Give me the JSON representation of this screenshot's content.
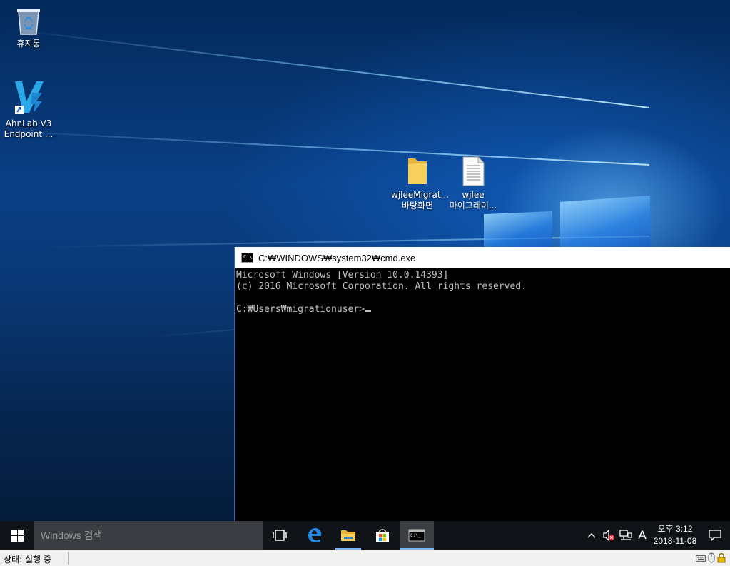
{
  "desktop_icons": {
    "recycle_bin": "휴지통",
    "ahnlab_line1": "AhnLab V3",
    "ahnlab_line2": "Endpoint ...",
    "folder_line1": "wjleeMigrat...",
    "folder_line2": "바탕화면",
    "doc_line1": "wjlee",
    "doc_line2": "마이그레이..."
  },
  "cmd_window": {
    "title": "C:₩WINDOWS₩system32₩cmd.exe",
    "lines": [
      "Microsoft Windows [Version 10.0.14393]",
      "(c) 2016 Microsoft Corporation. All rights reserved.",
      "",
      "C:₩Users₩migrationuser>"
    ]
  },
  "taskbar": {
    "search_placeholder": "Windows 검색",
    "apps": [
      "task-view",
      "edge",
      "file-explorer",
      "store",
      "cmd"
    ],
    "active_app": "cmd",
    "ime_indicator": "A",
    "clock_time": "오후 3:12",
    "clock_date": "2018-11-08"
  },
  "statusbar": {
    "text": "상태: 실행 중"
  },
  "colors": {
    "accent": "#7ab6f0",
    "taskbar_bg": "#101418",
    "search_bg": "#3a3d42",
    "console_bg": "#000000",
    "console_fg": "#c0c0c0"
  }
}
